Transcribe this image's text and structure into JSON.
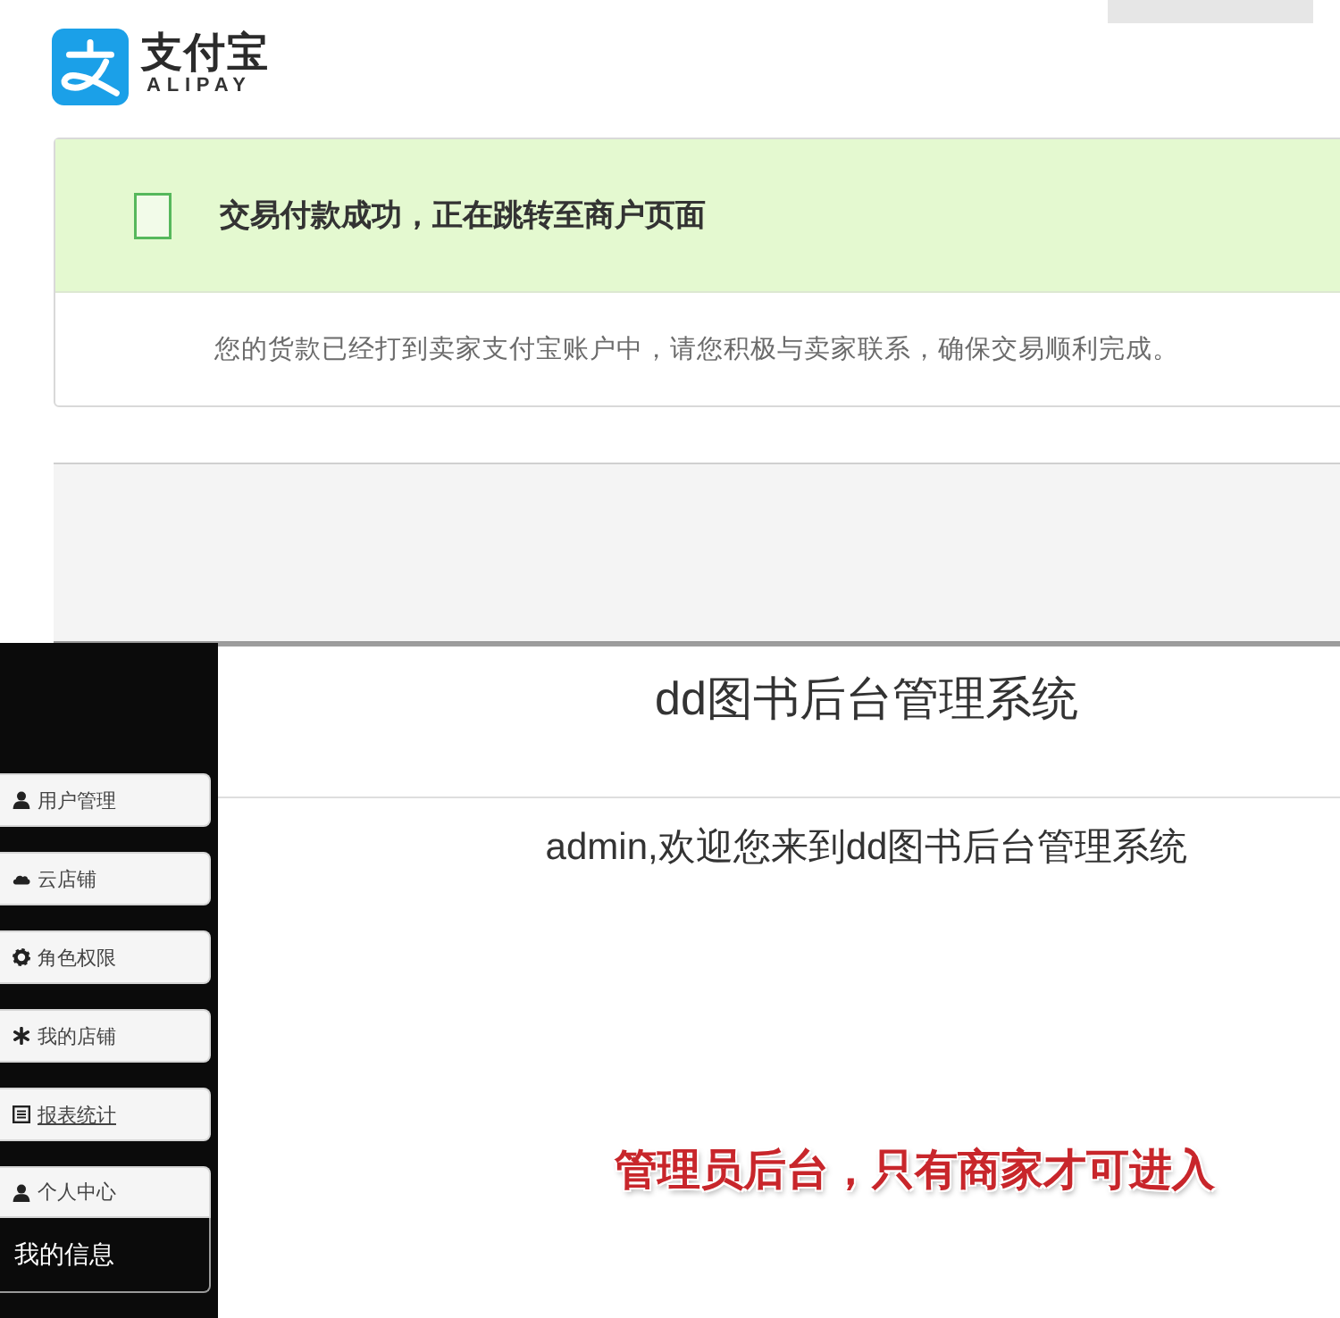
{
  "alipay_page": {
    "logo": {
      "name": "支付宝",
      "subtitle": "ALIPAY"
    },
    "notice": {
      "title": "交易付款成功，正在跳转至商户页面",
      "message": "您的货款已经打到卖家支付宝账户中，请您积极与卖家联系，确保交易顺利完成。"
    }
  },
  "admin_page": {
    "sidebar": {
      "items": [
        {
          "label": "用户管理",
          "hovered": false,
          "expanded": false
        },
        {
          "label": "云店铺",
          "hovered": false,
          "expanded": false
        },
        {
          "label": "角色权限",
          "hovered": false,
          "expanded": false
        },
        {
          "label": "我的店铺",
          "hovered": false,
          "expanded": false
        },
        {
          "label": "报表统计",
          "hovered": true,
          "expanded": false
        },
        {
          "label": "个人中心",
          "hovered": false,
          "expanded": true,
          "children": [
            {
              "label": "我的信息"
            }
          ]
        }
      ]
    },
    "header": {
      "title": "dd图书后台管理系统"
    },
    "welcome": "admin,欢迎您来到dd图书后台管理系统",
    "notice": "管理员后台，只有商家才可进入"
  }
}
